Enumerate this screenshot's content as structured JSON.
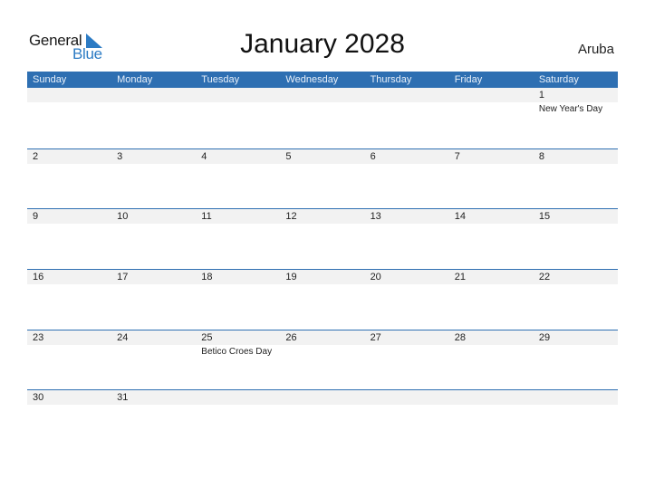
{
  "logo": {
    "word1": "General",
    "word2": "Blue"
  },
  "title": "January 2028",
  "country": "Aruba",
  "colors": {
    "header_bg": "#2e6fb2",
    "accent": "#2c7bc4",
    "date_strip": "#f2f2f2"
  },
  "weekdays": [
    "Sunday",
    "Monday",
    "Tuesday",
    "Wednesday",
    "Thursday",
    "Friday",
    "Saturday"
  ],
  "weeks": [
    [
      {
        "day": ""
      },
      {
        "day": ""
      },
      {
        "day": ""
      },
      {
        "day": ""
      },
      {
        "day": ""
      },
      {
        "day": ""
      },
      {
        "day": "1",
        "holiday": "New Year's Day"
      }
    ],
    [
      {
        "day": "2"
      },
      {
        "day": "3"
      },
      {
        "day": "4"
      },
      {
        "day": "5"
      },
      {
        "day": "6"
      },
      {
        "day": "7"
      },
      {
        "day": "8"
      }
    ],
    [
      {
        "day": "9"
      },
      {
        "day": "10"
      },
      {
        "day": "11"
      },
      {
        "day": "12"
      },
      {
        "day": "13"
      },
      {
        "day": "14"
      },
      {
        "day": "15"
      }
    ],
    [
      {
        "day": "16"
      },
      {
        "day": "17"
      },
      {
        "day": "18"
      },
      {
        "day": "19"
      },
      {
        "day": "20"
      },
      {
        "day": "21"
      },
      {
        "day": "22"
      }
    ],
    [
      {
        "day": "23"
      },
      {
        "day": "24"
      },
      {
        "day": "25",
        "holiday": "Betico Croes Day"
      },
      {
        "day": "26"
      },
      {
        "day": "27"
      },
      {
        "day": "28"
      },
      {
        "day": "29"
      }
    ],
    [
      {
        "day": "30"
      },
      {
        "day": "31"
      },
      {
        "day": ""
      },
      {
        "day": ""
      },
      {
        "day": ""
      },
      {
        "day": ""
      },
      {
        "day": ""
      }
    ]
  ]
}
